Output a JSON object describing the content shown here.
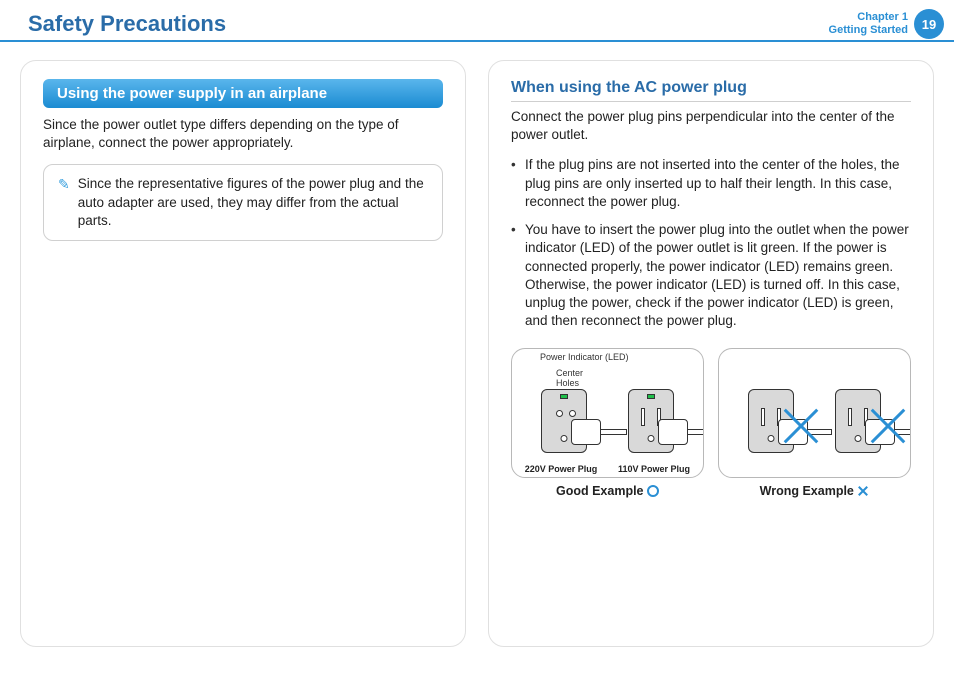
{
  "header": {
    "title": "Safety Precautions",
    "chapter_line1": "Chapter 1",
    "chapter_line2": "Getting Started",
    "page_number": "19"
  },
  "left": {
    "banner": "Using the power supply in an airplane",
    "intro": "Since the power outlet type differs depending on the type of airplane, connect the power appropriately.",
    "note": "Since the representative figures of the power plug and the auto adapter are used, they may differ from the actual parts."
  },
  "right": {
    "subheading": "When using the AC power plug",
    "intro": "Connect the power plug pins perpendicular into the center of the power outlet.",
    "bullets": [
      "If the plug pins are not inserted into the center of the holes, the plug pins are only inserted up to half their length. In this case, reconnect the power plug.",
      "You have to insert the power plug into the outlet when the power indicator (LED) of the power outlet is lit green. If the power is connected properly, the power indicator (LED) remains green.\nOtherwise, the power indicator (LED) is turned off. In this case, unplug the power, check if the power indicator (LED) is green, and then reconnect the power plug."
    ],
    "figure": {
      "led_label": "Power Indicator (LED)",
      "center_label_line1": "Center",
      "center_label_line2": "Holes",
      "plug220": "220V Power Plug",
      "plug110": "110V Power Plug",
      "good_caption": "Good Example",
      "wrong_caption": "Wrong Example"
    }
  }
}
